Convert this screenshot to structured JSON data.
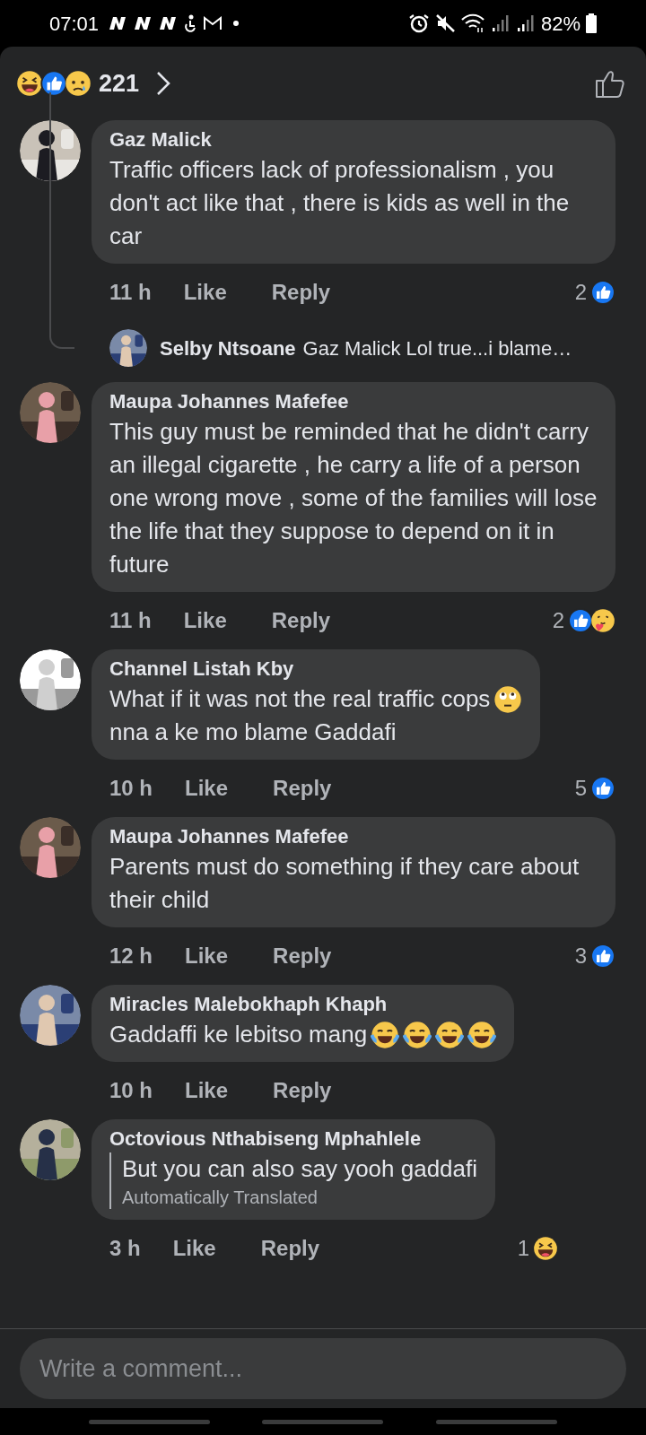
{
  "status_bar": {
    "time": "07:01",
    "battery": "82%"
  },
  "header": {
    "reactions": [
      {
        "kind": "haha"
      },
      {
        "kind": "like"
      },
      {
        "kind": "sad"
      }
    ],
    "count": "221"
  },
  "comments": [
    {
      "author": "Gaz Malick",
      "segments": [
        {
          "kind": "text",
          "text": "Traffic officers lack of professionalism , you don't act like that , there is kids as well in the car"
        }
      ],
      "time": "11 h",
      "like": "Like",
      "reply": "Reply",
      "reaction_count": "2",
      "reactions": [
        {
          "kind": "like"
        }
      ],
      "replies": [
        {
          "author": "Selby Ntsoane",
          "text": "Gaz Malick Lol true...i blame…"
        }
      ]
    },
    {
      "author": "Maupa Johannes Mafefee",
      "segments": [
        {
          "kind": "text",
          "text": "This guy must be reminded that he didn't carry an illegal cigarette , he carry a life of a person one wrong move , some of the families will lose the life that they suppose to depend on it in future"
        }
      ],
      "time": "11 h",
      "like": "Like",
      "reply": "Reply",
      "reaction_count": "2",
      "reactions": [
        {
          "kind": "like"
        },
        {
          "kind": "care"
        }
      ]
    },
    {
      "author": "Channel Listah Kby",
      "segments": [
        {
          "kind": "text",
          "text": "What if it was not the real traffic cops",
          "emojis": [
            {
              "kind": "eye-roll"
            }
          ]
        },
        {
          "kind": "text",
          "text": "nna a ke mo blame Gaddafi"
        }
      ],
      "time": "10 h",
      "like": "Like",
      "reply": "Reply",
      "reaction_count": "5",
      "reactions": [
        {
          "kind": "like"
        }
      ]
    },
    {
      "author": "Maupa Johannes Mafefee",
      "segments": [
        {
          "kind": "text",
          "text": "Parents must do something if they care about their child"
        }
      ],
      "time": "12 h",
      "like": "Like",
      "reply": "Reply",
      "reaction_count": "3",
      "reactions": [
        {
          "kind": "like"
        }
      ]
    },
    {
      "author": "Miracles Malebokhaph Khaph",
      "segments": [
        {
          "kind": "text",
          "text": "Gaddaffi ke lebitso mang",
          "emojis": [
            {
              "kind": "tears-of-joy"
            },
            {
              "kind": "tears-of-joy"
            },
            {
              "kind": "tears-of-joy"
            },
            {
              "kind": "tears-of-joy"
            }
          ]
        }
      ],
      "time": "10 h",
      "like": "Like",
      "reply": "Reply"
    },
    {
      "author": "Octovious Nthabiseng Mphahlele",
      "segments": [
        {
          "kind": "text",
          "text": "But you can also say yooh gaddafi"
        }
      ],
      "translation_note": "Automatically Translated",
      "time": "3 h",
      "like": "Like",
      "reply": "Reply",
      "reaction_count": "1",
      "reactions": [
        {
          "kind": "haha"
        }
      ]
    }
  ],
  "composer": {
    "placeholder": "Write a comment..."
  }
}
